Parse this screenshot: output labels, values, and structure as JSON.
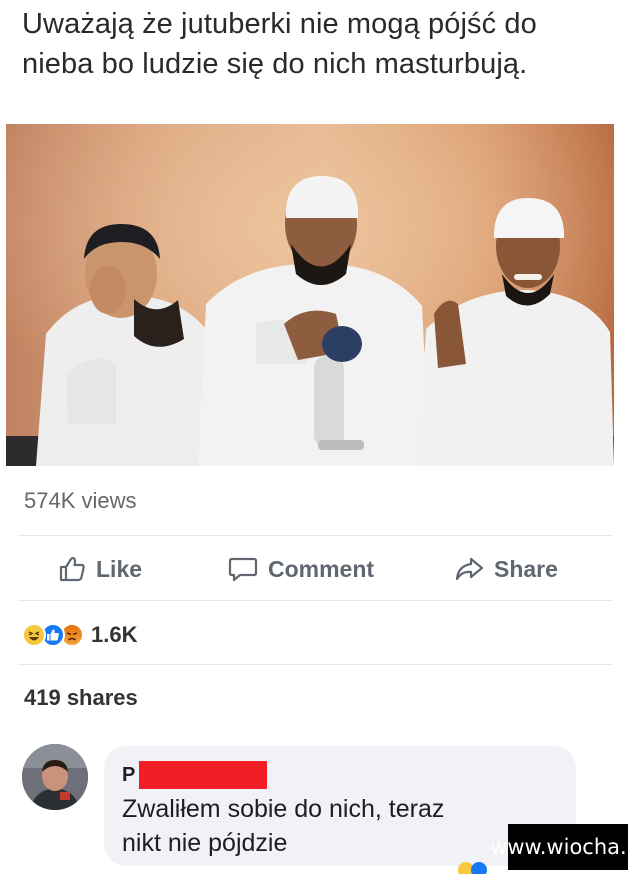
{
  "post": {
    "caption": "Uważają że jutuberki nie mogą pójść do nieba bo ludzie się do nich masturbują."
  },
  "video": {
    "thumbnail": "three-men-in-white-robes-with-microphone",
    "views": "574K views"
  },
  "actions": {
    "like_label": "Like",
    "comment_label": "Comment",
    "share_label": "Share"
  },
  "reactions": {
    "icons": [
      "haha-reaction-icon",
      "like-reaction-icon",
      "angry-reaction-icon"
    ],
    "count": "1.6K"
  },
  "shares": "419 shares",
  "comment": {
    "author_initial": "P",
    "text_line1": "Zwaliłem sobie do nich, teraz",
    "text_line2": "nikt nie pójdzie"
  },
  "watermark": "www.wiocha.pl",
  "colors": {
    "redaction": "#f21d25",
    "like_blue": "#1877f2",
    "haha_yellow": "#f7c83b",
    "angry_orange": "#e9710f",
    "icon_gray": "#606770",
    "bubble_bg": "#f0f2f5"
  }
}
